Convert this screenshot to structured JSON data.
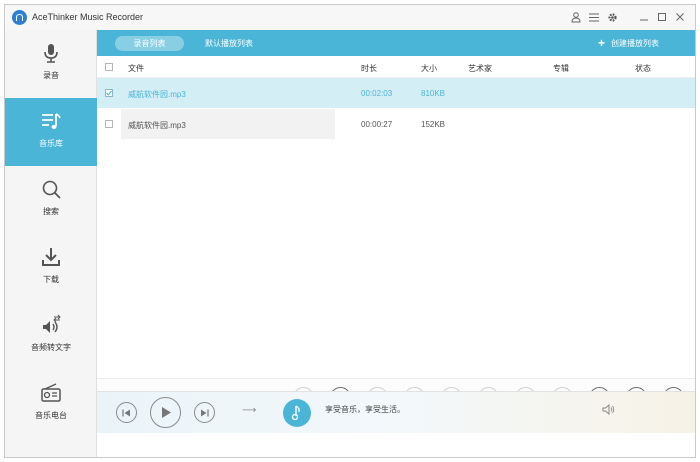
{
  "app": {
    "title": "AceThinker Music Recorder"
  },
  "titlebar": {
    "icons": [
      "user-icon",
      "menu-icon",
      "gear-icon",
      "minimize-icon",
      "maximize-icon",
      "close-icon"
    ]
  },
  "sidebar": {
    "items": [
      {
        "label": "录音",
        "icon": "microphone-icon",
        "active": false
      },
      {
        "label": "音乐库",
        "icon": "music-library-icon",
        "active": true
      },
      {
        "label": "搜索",
        "icon": "search-icon",
        "active": false
      },
      {
        "label": "下载",
        "icon": "download-icon",
        "active": false
      },
      {
        "label": "音频转文字",
        "icon": "audio-to-text-icon",
        "active": false
      },
      {
        "label": "音乐电台",
        "icon": "radio-icon",
        "active": false
      }
    ]
  },
  "tabs": {
    "recording_list": "录音列表",
    "default_playlist": "默认播放列表",
    "create_playlist": "创建播放列表"
  },
  "table": {
    "headers": {
      "file": "文件",
      "duration": "时长",
      "size": "大小",
      "artist": "艺术家",
      "album": "专辑",
      "status": "状态"
    },
    "rows": [
      {
        "file": "威航软件园.mp3",
        "duration": "00:02:03",
        "size": "810KB",
        "artist": "",
        "album": "",
        "status": "",
        "checked": true,
        "selected": true
      },
      {
        "file": "威航软件园.mp3",
        "duration": "00:00:27",
        "size": "152KB",
        "artist": "",
        "album": "",
        "status": "",
        "checked": false,
        "selected": false
      }
    ]
  },
  "actions": [
    "play-icon",
    "convert-icon",
    "edit-icon",
    "search-info-icon",
    "edit-tag-icon",
    "cancel-icon",
    "delete-icon",
    "id3-icon",
    "tag-icon",
    "folder-icon",
    "clock-icon"
  ],
  "player": {
    "slogan": "享受音乐，享受生活。",
    "arrow": "⟶"
  },
  "colors": {
    "accent": "#4ab5d6",
    "selected_row": "#d4eef6"
  }
}
